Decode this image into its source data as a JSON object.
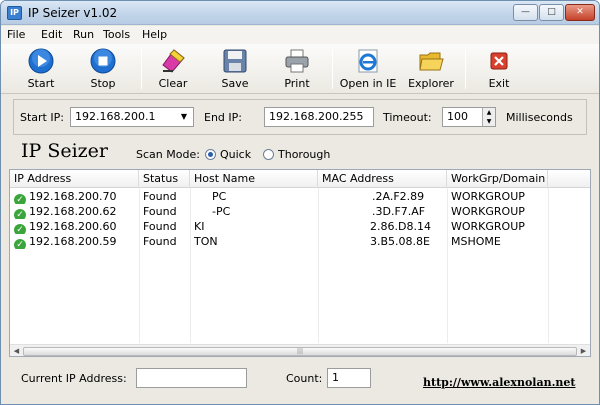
{
  "window": {
    "title": "IP Seizer v1.02",
    "icon": "app-icon",
    "min": "—",
    "max": "□",
    "close": "✕"
  },
  "menu": [
    "File",
    "Edit",
    "Run",
    "Tools",
    "Help"
  ],
  "toolbar": {
    "start": "Start",
    "stop": "Stop",
    "clear": "Clear",
    "save": "Save",
    "print": "Print",
    "open_ie": "Open in IE",
    "explorer": "Explorer",
    "exit": "Exit"
  },
  "params": {
    "start_ip_label": "Start IP:",
    "start_ip": "192.168.200.1",
    "end_ip_label": "End IP:",
    "end_ip": "192.168.200.255",
    "timeout_label": "Timeout:",
    "timeout": "100",
    "timeout_unit": "Milliseconds"
  },
  "heading": "IP Seizer",
  "scan_mode": {
    "label": "Scan Mode:",
    "quick": "Quick",
    "thorough": "Thorough",
    "selected": "quick"
  },
  "table": {
    "columns": [
      "IP Address",
      "Status",
      "Host Name",
      "MAC Address",
      "WorkGrp/Domain"
    ],
    "rows": [
      {
        "ip": "192.168.200.70",
        "status": "Found",
        "host": "PC",
        "mac": ".2A.F2.89",
        "group": "WORKGROUP"
      },
      {
        "ip": "192.168.200.62",
        "status": "Found",
        "host": "-PC",
        "mac": ".3D.F7.AF",
        "group": "WORKGROUP"
      },
      {
        "ip": "192.168.200.60",
        "status": "Found",
        "host": "KI",
        "mac": "2.86.D8.14",
        "group": "WORKGROUP"
      },
      {
        "ip": "192.168.200.59",
        "status": "Found",
        "host": "TON",
        "mac": "3.B5.08.8E",
        "group": "MSHOME"
      }
    ]
  },
  "footer": {
    "current_ip_label": "Current IP Address:",
    "current_ip": "",
    "count_label": "Count:",
    "count": "1",
    "link": "http://www.alexnolan.net"
  },
  "colors": {
    "title_bar": "#c4d6ea",
    "accent": "#2b6fd4",
    "check": "#3aa53a"
  }
}
